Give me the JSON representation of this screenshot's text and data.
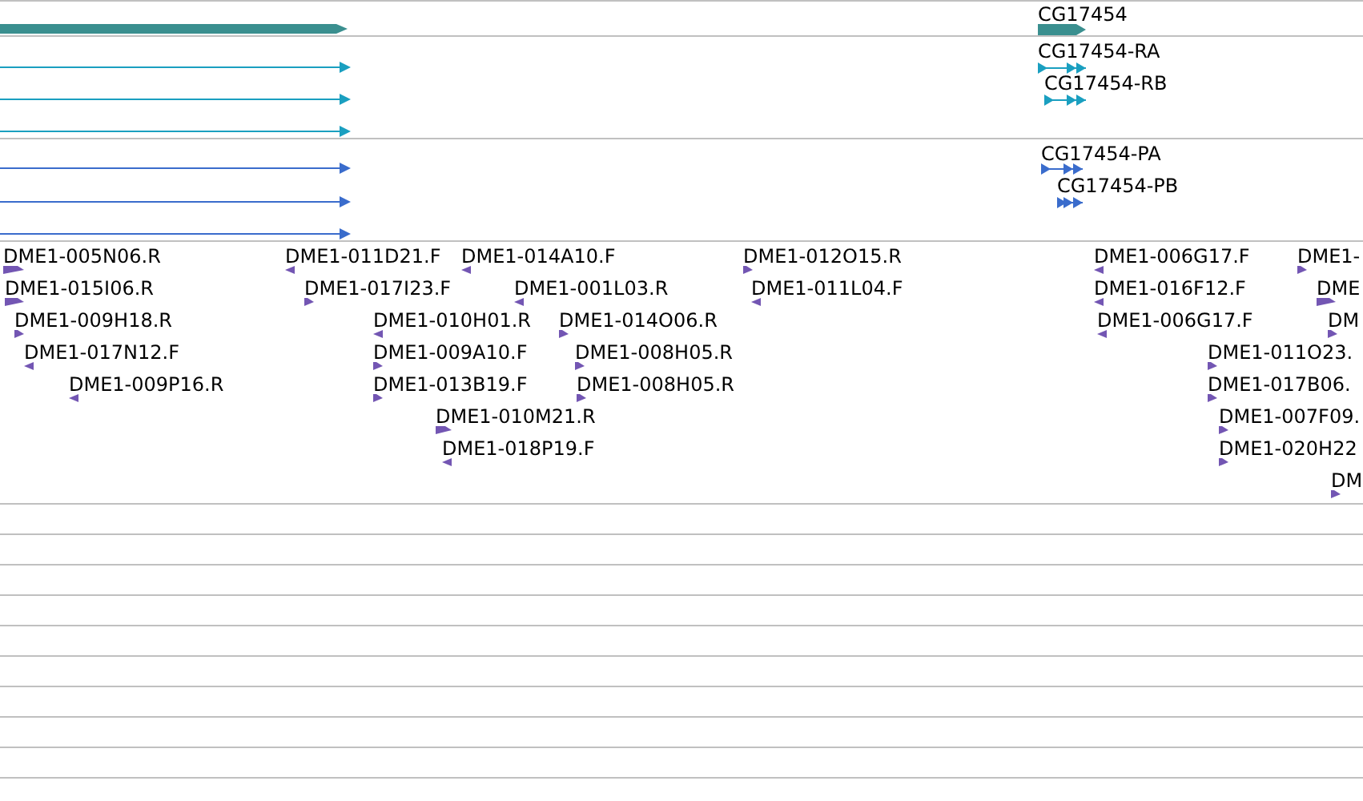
{
  "tracks": [
    {
      "kind": "gene",
      "color": "#3a8f8f",
      "features": [
        {
          "reverse": false
        },
        {
          "label": "CG17454",
          "reverse": false
        }
      ]
    },
    {
      "kind": "transcript",
      "color": "#1a9fc0",
      "features": [
        {
          "reverse": false
        },
        {
          "reverse": false
        },
        {
          "reverse": false
        },
        {
          "label": "CG17454-RA",
          "reverse": false
        },
        {
          "label": "CG17454-RB",
          "reverse": false
        }
      ]
    },
    {
      "kind": "transcript",
      "color": "#3a6ccc",
      "features": [
        {
          "reverse": false
        },
        {
          "reverse": false
        },
        {
          "reverse": false
        },
        {
          "label": "CG17454-PA",
          "reverse": false
        },
        {
          "label": "CG17454-PB",
          "reverse": false
        }
      ]
    },
    {
      "kind": "est",
      "color": "#7356b3",
      "features": [
        {
          "label": "DME1-005N06.R",
          "reverse": false
        },
        {
          "label": "DME1-011D21.F",
          "reverse": true
        },
        {
          "label": "DME1-014A10.F",
          "reverse": true
        },
        {
          "label": "DME1-012O15.R",
          "reverse": false
        },
        {
          "label": "DME1-006G17.F",
          "reverse": true
        },
        {
          "label": "DME1-",
          "reverse": false
        },
        {
          "label": "DME1-015I06.R",
          "reverse": false
        },
        {
          "label": "DME1-017I23.F",
          "reverse": false
        },
        {
          "label": "DME1-001L03.R",
          "reverse": true
        },
        {
          "label": "DME1-011L04.F",
          "reverse": true
        },
        {
          "label": "DME1-016F12.F",
          "reverse": true
        },
        {
          "label": "DME",
          "reverse": false
        },
        {
          "label": "DME1-009H18.R",
          "reverse": false
        },
        {
          "label": "DME1-010H01.R",
          "reverse": true
        },
        {
          "label": "DME1-014O06.R",
          "reverse": false
        },
        {
          "label": "DME1-006G17.F",
          "reverse": true
        },
        {
          "label": "DM",
          "reverse": false
        },
        {
          "label": "DME1-017N12.F",
          "reverse": true
        },
        {
          "label": "DME1-009A10.F",
          "reverse": false
        },
        {
          "label": "DME1-008H05.R",
          "reverse": false
        },
        {
          "label": "DME1-011O23.",
          "reverse": false
        },
        {
          "label": "DME1-009P16.R",
          "reverse": true
        },
        {
          "label": "DME1-013B19.F",
          "reverse": false
        },
        {
          "label": "DME1-008H05.R",
          "reverse": false
        },
        {
          "label": "DME1-017B06.",
          "reverse": false
        },
        {
          "label": "DME1-010M21.R",
          "reverse": false
        },
        {
          "label": "DME1-007F09.",
          "reverse": false
        },
        {
          "label": "DME1-018P19.F",
          "reverse": true
        },
        {
          "label": "DME1-020H22",
          "reverse": false
        },
        {
          "label": "DM",
          "reverse": false
        }
      ]
    }
  ]
}
